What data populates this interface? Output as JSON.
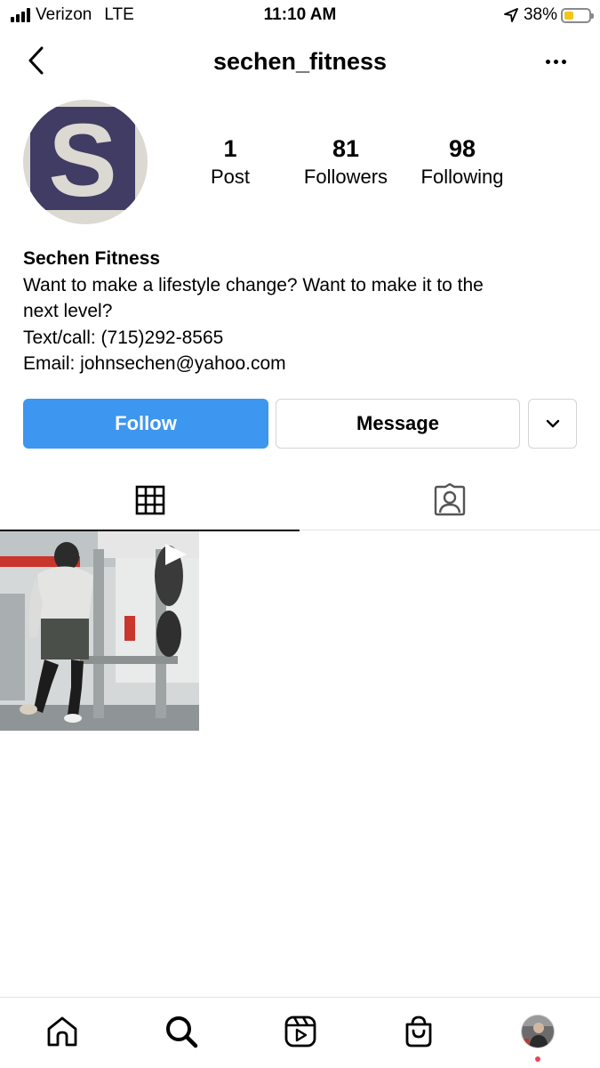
{
  "status_bar": {
    "carrier": "Verizon",
    "network": "LTE",
    "time": "11:10 AM",
    "battery_percent": "38%",
    "battery_level": 0.38,
    "signal_icon": "signal-bars-icon",
    "location_icon": "location-arrow-icon",
    "battery_icon": "battery-icon"
  },
  "header": {
    "username": "sechen_fitness",
    "back_icon": "chevron-left-icon",
    "more_icon": "more-horizontal-icon"
  },
  "profile": {
    "avatar_letter": "S",
    "avatar_colors": {
      "background": "#dcd8d2",
      "square": "#403c64"
    },
    "stats": [
      {
        "value": "1",
        "label": "Post"
      },
      {
        "value": "81",
        "label": "Followers"
      },
      {
        "value": "98",
        "label": "Following"
      }
    ],
    "name": "Sechen Fitness",
    "bio_lines": [
      "Want to make a lifestyle change? Want to make it to the",
      "next level?",
      "Text/call: (715)292-8565",
      "Email: johnsechen@yahoo.com"
    ]
  },
  "actions": {
    "follow_label": "Follow",
    "message_label": "Message",
    "more_icon": "chevron-down-icon",
    "follow_color": "#3d96ef"
  },
  "tabs": [
    {
      "name": "grid",
      "icon": "grid-icon",
      "active": true
    },
    {
      "name": "tagged",
      "icon": "tagged-person-icon",
      "active": false
    }
  ],
  "posts": [
    {
      "type": "video",
      "icon": "play-icon"
    }
  ],
  "bottom_nav": [
    {
      "name": "home",
      "icon": "home-icon"
    },
    {
      "name": "search",
      "icon": "search-icon"
    },
    {
      "name": "reels",
      "icon": "reels-icon"
    },
    {
      "name": "shop",
      "icon": "shopping-bag-icon"
    },
    {
      "name": "profile",
      "icon": "profile-avatar-icon"
    }
  ]
}
